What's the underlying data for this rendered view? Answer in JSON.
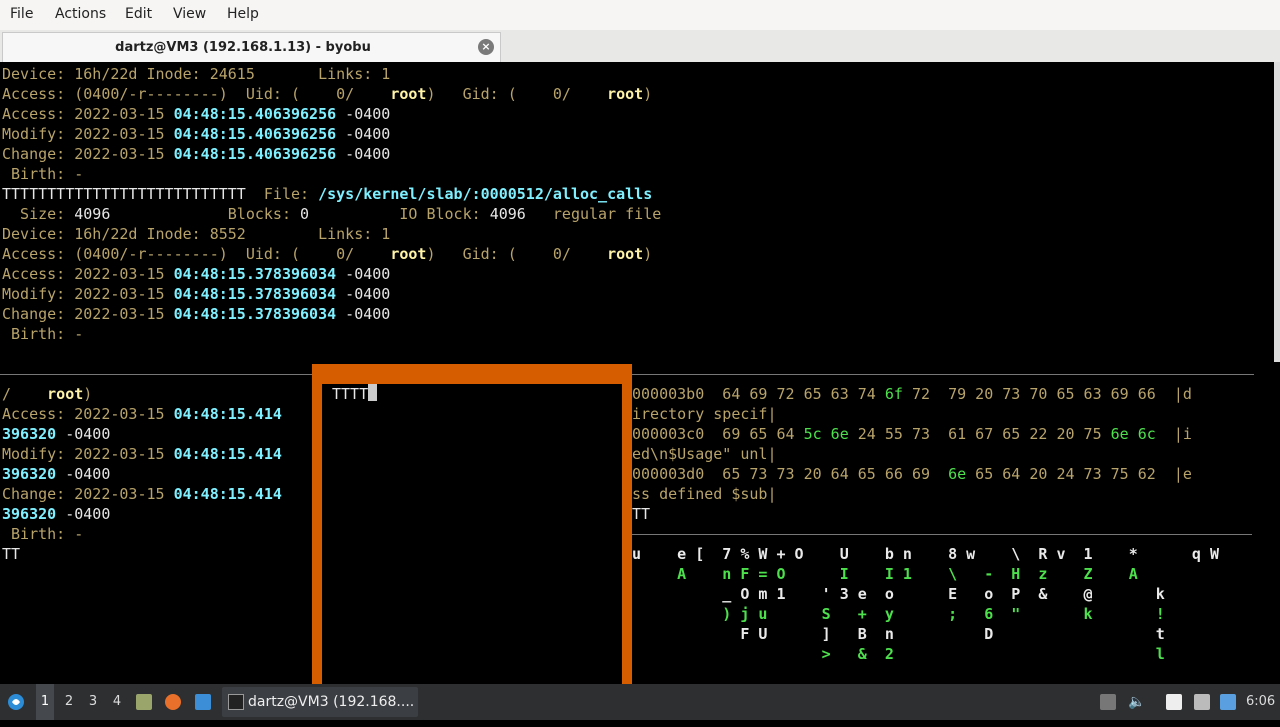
{
  "menu": {
    "file": "File",
    "actions": "Actions",
    "edit": "Edit",
    "view": "View",
    "help": "Help"
  },
  "tab": {
    "title": "dartz@VM3 (192.168.1.13) - byobu",
    "close": "×"
  },
  "pane_top": [
    [
      {
        "t": "Device: 16h/22d Inode: 24615       Links: 1",
        "c": "y"
      }
    ],
    [
      {
        "t": "Access: (0400/-r--------)  Uid: (    0/    ",
        "c": "y"
      },
      {
        "t": "root",
        "c": "b"
      },
      {
        "t": ")   Gid: (    0/    ",
        "c": "y"
      },
      {
        "t": "root",
        "c": "b"
      },
      {
        "t": ")",
        "c": "y"
      }
    ],
    [
      {
        "t": "Access: 2022-03-15 ",
        "c": "y"
      },
      {
        "t": "04:48:15.406396256",
        "c": "c"
      },
      {
        "t": " -0400",
        "c": "w"
      }
    ],
    [
      {
        "t": "Modify: 2022-03-15 ",
        "c": "y"
      },
      {
        "t": "04:48:15.406396256",
        "c": "c"
      },
      {
        "t": " -0400",
        "c": "w"
      }
    ],
    [
      {
        "t": "Change: 2022-03-15 ",
        "c": "y"
      },
      {
        "t": "04:48:15.406396256",
        "c": "c"
      },
      {
        "t": " -0400",
        "c": "w"
      }
    ],
    [
      {
        "t": " Birth: -",
        "c": "y"
      }
    ],
    [
      {
        "t": "TTTTTTTTTTTTTTTTTTTTTTTTTTT  ",
        "c": "w"
      },
      {
        "t": "File: ",
        "c": "y"
      },
      {
        "t": "/sys/kernel/slab/:0000512/alloc_calls",
        "c": "c"
      }
    ],
    [
      {
        "t": "  Size: ",
        "c": "y"
      },
      {
        "t": "4096",
        "c": "w"
      },
      {
        "t": "             Blocks: ",
        "c": "y"
      },
      {
        "t": "0",
        "c": "w"
      },
      {
        "t": "          IO Block: ",
        "c": "y"
      },
      {
        "t": "4096",
        "c": "w"
      },
      {
        "t": "   regular file",
        "c": "y"
      }
    ],
    [
      {
        "t": "Device: 16h/22d Inode: 8552        Links: 1",
        "c": "y"
      }
    ],
    [
      {
        "t": "Access: (0400/-r--------)  Uid: (    0/    ",
        "c": "y"
      },
      {
        "t": "root",
        "c": "b"
      },
      {
        "t": ")   Gid: (    0/    ",
        "c": "y"
      },
      {
        "t": "root",
        "c": "b"
      },
      {
        "t": ")",
        "c": "y"
      }
    ],
    [
      {
        "t": "Access: 2022-03-15 ",
        "c": "y"
      },
      {
        "t": "04:48:15.378396034",
        "c": "c"
      },
      {
        "t": " -0400",
        "c": "w"
      }
    ],
    [
      {
        "t": "Modify: 2022-03-15 ",
        "c": "y"
      },
      {
        "t": "04:48:15.378396034",
        "c": "c"
      },
      {
        "t": " -0400",
        "c": "w"
      }
    ],
    [
      {
        "t": "Change: 2022-03-15 ",
        "c": "y"
      },
      {
        "t": "04:48:15.378396034",
        "c": "c"
      },
      {
        "t": " -0400",
        "c": "w"
      }
    ],
    [
      {
        "t": " Birth: -",
        "c": "y"
      }
    ]
  ],
  "pane_left": [
    [
      {
        "t": "/    ",
        "c": "y"
      },
      {
        "t": "root",
        "c": "b"
      },
      {
        "t": ")",
        "c": "y"
      }
    ],
    [
      {
        "t": "Access: 2022-03-15 ",
        "c": "y"
      },
      {
        "t": "04:48:15.414",
        "c": "c"
      }
    ],
    [
      {
        "t": "396320",
        "c": "c"
      },
      {
        "t": " -0400",
        "c": "w"
      }
    ],
    [
      {
        "t": "Modify: 2022-03-15 ",
        "c": "y"
      },
      {
        "t": "04:48:15.414",
        "c": "c"
      }
    ],
    [
      {
        "t": "396320",
        "c": "c"
      },
      {
        "t": " -0400",
        "c": "w"
      }
    ],
    [
      {
        "t": "Change: 2022-03-15 ",
        "c": "y"
      },
      {
        "t": "04:48:15.414",
        "c": "c"
      }
    ],
    [
      {
        "t": "396320",
        "c": "c"
      },
      {
        "t": " -0400",
        "c": "w"
      }
    ],
    [
      {
        "t": " Birth: -",
        "c": "y"
      }
    ],
    [
      {
        "t": "TT",
        "c": "w"
      }
    ]
  ],
  "popup": {
    "text": "TTTT"
  },
  "pane_right": [
    [
      {
        "t": "000003b0  64 69 72 65 63 74 ",
        "c": "y"
      },
      {
        "t": "6f",
        "c": "g"
      },
      {
        "t": " 72  79 20 73 70 65 63 69 66  |d",
        "c": "y"
      }
    ],
    [
      {
        "t": "irectory specif|",
        "c": "y"
      }
    ],
    [
      {
        "t": "000003c0  69 65 64 ",
        "c": "y"
      },
      {
        "t": "5c 6e",
        "c": "g"
      },
      {
        "t": " 24 55 73  61 67 65 22 20 75 ",
        "c": "y"
      },
      {
        "t": "6e 6c",
        "c": "g"
      },
      {
        "t": "  |i",
        "c": "y"
      }
    ],
    [
      {
        "t": "ed\\n$Usage\" unl|",
        "c": "y"
      }
    ],
    [
      {
        "t": "000003d0  65 73 73 20 64 65 66 69  ",
        "c": "y"
      },
      {
        "t": "6e",
        "c": "g"
      },
      {
        "t": " 65 64 20 24 73 75 62  |e",
        "c": "y"
      }
    ],
    [
      {
        "t": "ss defined $sub|",
        "c": "y"
      }
    ],
    [
      {
        "t": "TT",
        "c": "w"
      }
    ]
  ],
  "matrix": [
    "u    e [  7 % W + O    U    b n    8 w    \\  R v  1    *      q W",
    "     A    n F = O      I    I 1    \\   -  H  z    Z    A",
    "          _ O m 1    ' 3 e  o      E   o  P  &    @       k",
    "          ) j u      S   +  y      ;   6  \"       k       !",
    "            F U      ]   B  n          D                  t",
    "                     >   &  2                             l"
  ],
  "taskbar": {
    "workspaces": [
      "1",
      "2",
      "3",
      "4"
    ],
    "task_label": "dartz@VM3 (192.168....",
    "clock": "6:06"
  }
}
